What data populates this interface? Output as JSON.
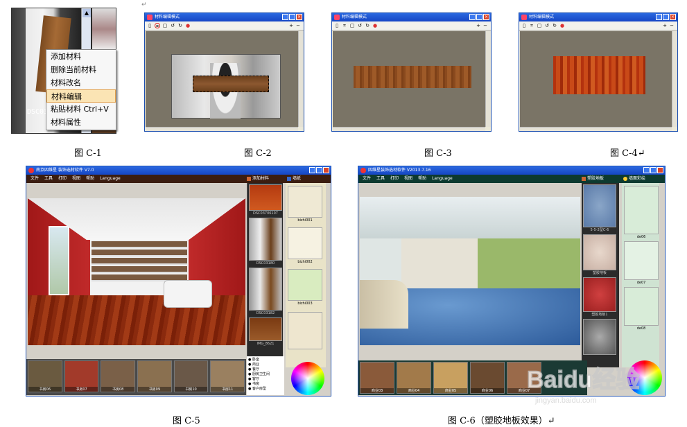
{
  "page": {
    "paragraph_mark": "↵"
  },
  "captions": {
    "c1": "图 C-1",
    "c2": "图 C-2",
    "c3": "图 C-3",
    "c4": "图 C-4↵",
    "c5": "图 C-5",
    "c6": "图 C-6（塑胶地板效果）↵"
  },
  "c1": {
    "photo_caption": "DSC03",
    "context_menu": [
      {
        "label": "添加材料"
      },
      {
        "label": "删除当前材料"
      },
      {
        "label": "材料改名"
      },
      {
        "label": "材料编辑",
        "highlighted": true
      },
      {
        "label": "粘贴材料  Ctrl+V"
      },
      {
        "label": "材料属性"
      }
    ]
  },
  "editor": {
    "title": "材料编辑模式",
    "close": "×",
    "tools": [
      "undo-icon",
      "crop-icon",
      "select-icon",
      "rotate-left-icon",
      "rotate-right-icon",
      "color-icon"
    ],
    "zoom_in": "+",
    "zoom_out": "−"
  },
  "c5": {
    "title": "南京四维星 装饰选材软件 V7.0",
    "menu": [
      "文件",
      "工具",
      "打印",
      "视图",
      "帮助",
      "Language"
    ],
    "material_tab": "添加材料",
    "wall_tab": "墙纸",
    "materials": [
      "DSC03706107",
      "DSC03180",
      "DSC03182",
      "IMG_8621"
    ],
    "wallpapers": [
      "bizhi001",
      "bizhi002",
      "bizhi003"
    ],
    "scenes": [
      "书房06",
      "书房07",
      "书房08",
      "书房09",
      "书房10",
      "书房11"
    ],
    "radios": [
      "卧室",
      "商业",
      "餐厅",
      "厨房卫生间",
      "客厅",
      "书房",
      "客户房型"
    ]
  },
  "c6": {
    "title": "四维星装饰选材软件 V2013.7.16",
    "menu": [
      "文件",
      "工具",
      "打印",
      "视图",
      "帮助",
      "Language"
    ],
    "material_tab": "塑胶地板",
    "wall_tab": "墙面彩绘",
    "materials": [
      "5-5-2型C-6",
      "塑胶地板",
      "塑胶地板1"
    ],
    "wallpapers": [
      "de06",
      "de07",
      "de08"
    ],
    "scenes": [
      "商业03",
      "商业04",
      "商业05",
      "商业06",
      "商业07"
    ]
  },
  "watermark": {
    "brand": "Baidu经验",
    "url": "jingyan.baidu.com"
  }
}
